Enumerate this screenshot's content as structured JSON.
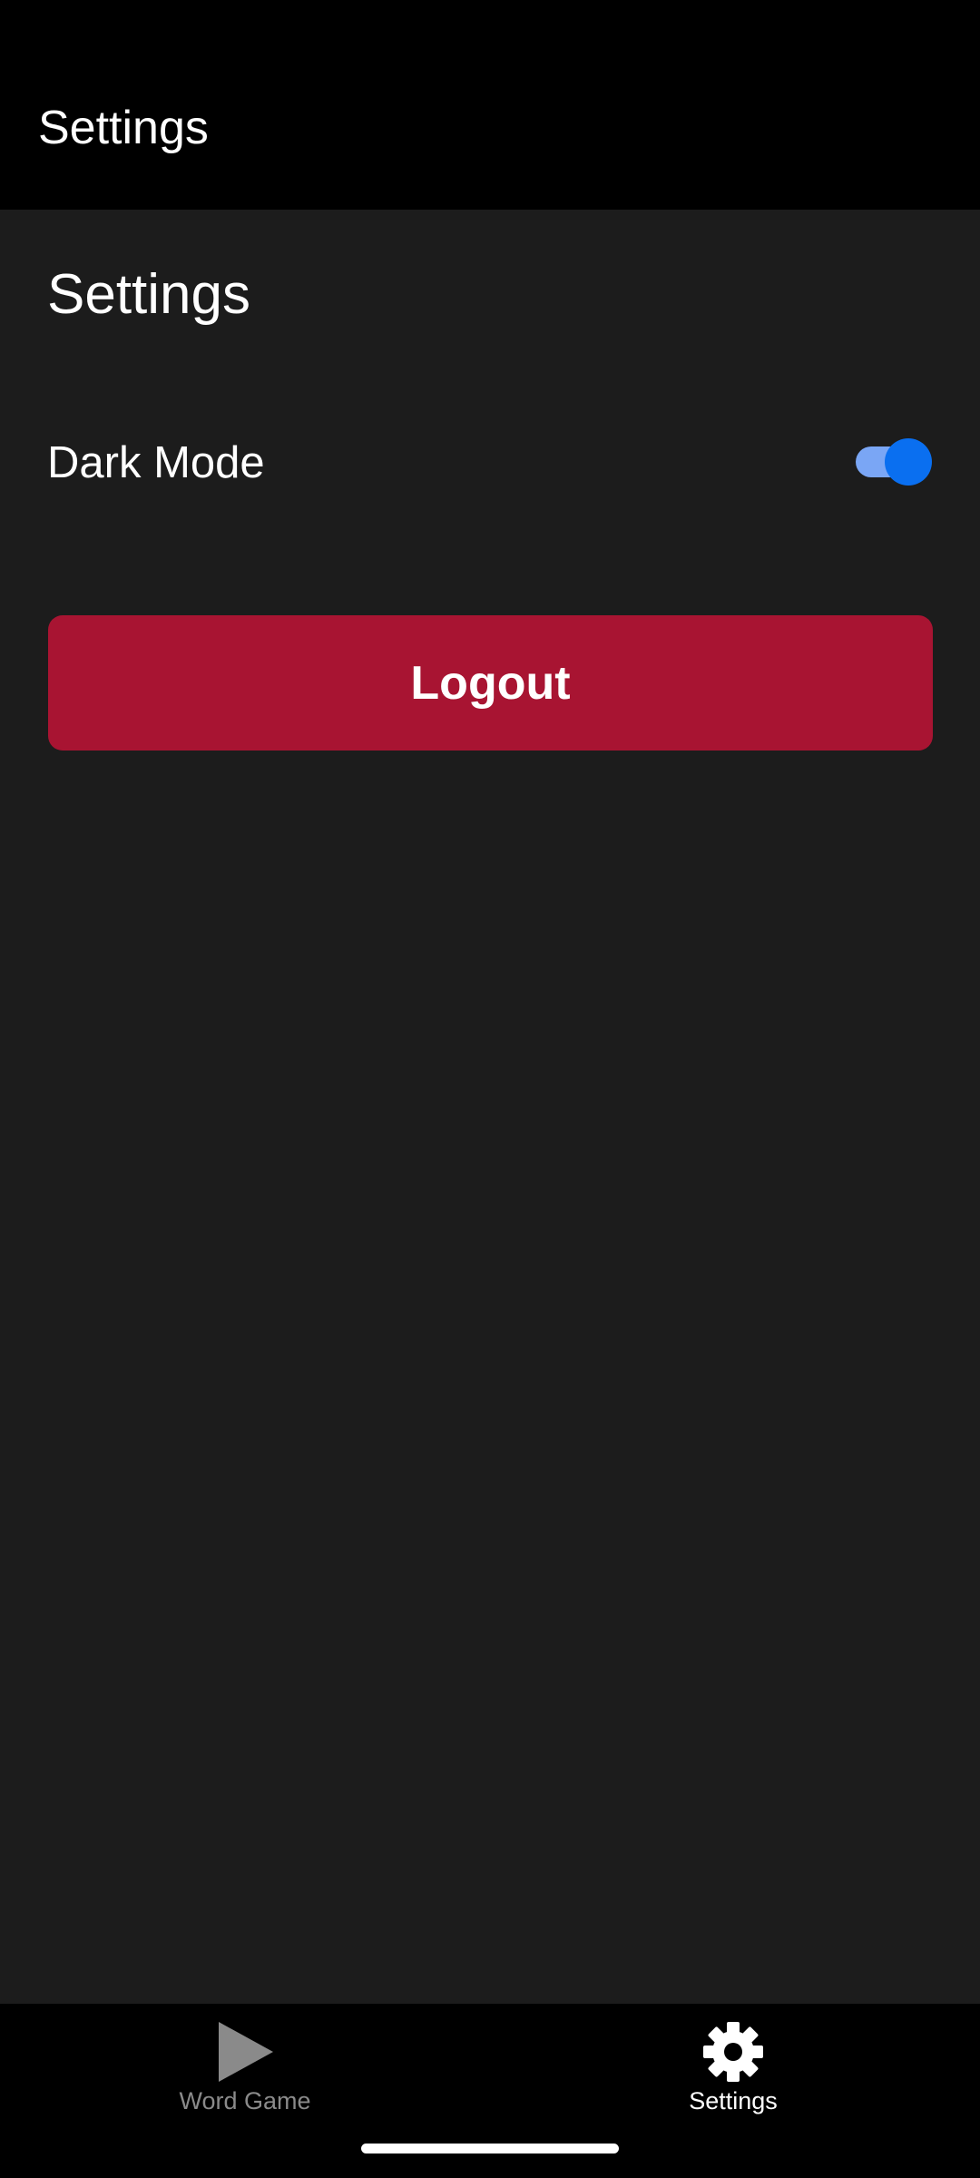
{
  "header": {
    "title": "Settings"
  },
  "content": {
    "section_title": "Settings",
    "dark_mode": {
      "label": "Dark Mode",
      "enabled": true
    },
    "logout_button": {
      "label": "Logout",
      "color": "#a81432"
    }
  },
  "bottom_nav": {
    "items": [
      {
        "label": "Word Game",
        "icon": "play-icon",
        "active": false
      },
      {
        "label": "Settings",
        "icon": "gear-icon",
        "active": true
      }
    ]
  },
  "colors": {
    "toggle_accent": "#0a6ff0",
    "background": "#1c1c1c",
    "bar_background": "#000000"
  }
}
